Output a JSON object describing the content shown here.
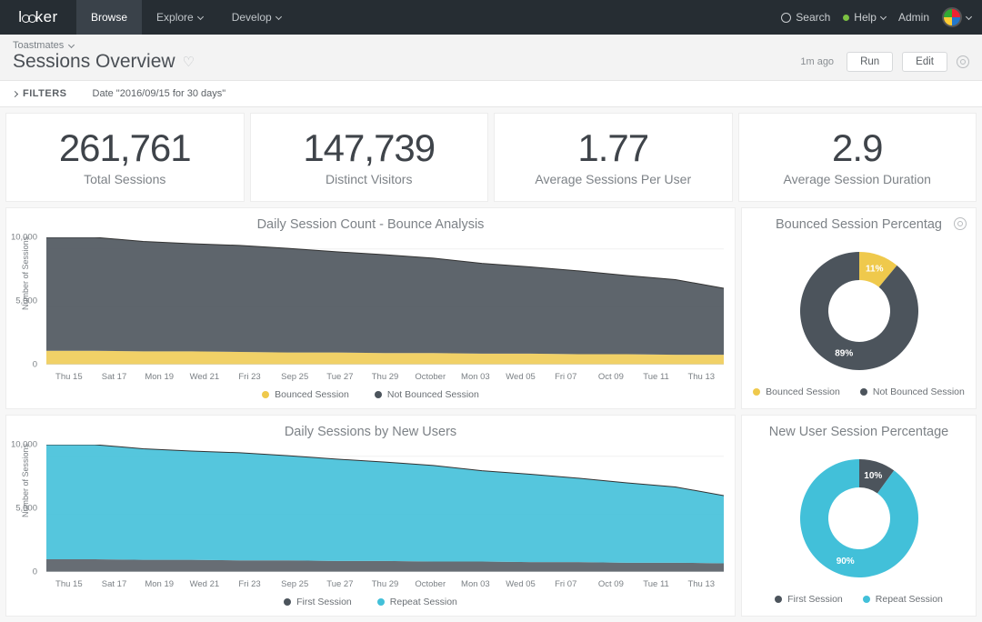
{
  "nav": {
    "logo_prefix": "l",
    "logo_mid": "",
    "logo_suffix": "ker",
    "tabs": [
      {
        "label": "Browse",
        "active": true
      },
      {
        "label": "Explore"
      },
      {
        "label": "Develop"
      }
    ],
    "search": "Search",
    "help": "Help",
    "admin": "Admin"
  },
  "breadcrumb": "Toastmates",
  "title": "Sessions Overview",
  "ago": "1m ago",
  "run_btn": "Run",
  "edit_btn": "Edit",
  "filters_label": "FILTERS",
  "filters_text": "Date \"2016/09/15 for 30 days\"",
  "kpis": [
    {
      "value": "261,761",
      "label": "Total Sessions"
    },
    {
      "value": "147,739",
      "label": "Distinct Visitors"
    },
    {
      "value": "1.77",
      "label": "Average Sessions Per User"
    },
    {
      "value": "2.9",
      "label": "Average Session Duration"
    }
  ],
  "chart_data": [
    {
      "type": "area",
      "title": "Daily Session Count - Bounce Analysis",
      "ylabel": "Number of Sessions",
      "ylim": [
        0,
        11000
      ],
      "yticks": [
        0,
        5000,
        10000
      ],
      "categories": [
        "Thu 15",
        "Sat 17",
        "Mon 19",
        "Wed 21",
        "Fri 23",
        "Sep 25",
        "Tue 27",
        "Thu 29",
        "October",
        "Mon 03",
        "Wed 05",
        "Fri 07",
        "Oct 09",
        "Tue 11",
        "Thu 13"
      ],
      "series": [
        {
          "name": "Bounced Session",
          "color": "#efc94c",
          "values": [
            1200,
            1200,
            1150,
            1150,
            1100,
            1050,
            1050,
            1000,
            1000,
            950,
            950,
            900,
            900,
            850,
            850
          ]
        },
        {
          "name": "Not Bounced Session",
          "color": "#4c545c",
          "values": [
            9800,
            9800,
            9500,
            9300,
            9200,
            9000,
            8700,
            8500,
            8200,
            7800,
            7500,
            7200,
            6800,
            6500,
            5750
          ]
        }
      ],
      "legend": [
        "Bounced Session",
        "Not Bounced Session"
      ]
    },
    {
      "type": "pie",
      "title": "Bounced Session Percentag",
      "series": [
        {
          "name": "Bounced Session",
          "value": 11,
          "color": "#efc94c"
        },
        {
          "name": "Not Bounced Session",
          "value": 89,
          "color": "#4c545c"
        }
      ],
      "legend": [
        "Bounced Session",
        "Not Bounced Session"
      ]
    },
    {
      "type": "area",
      "title": "Daily Sessions by New Users",
      "ylabel": "Number of Sessions",
      "ylim": [
        0,
        11000
      ],
      "yticks": [
        0,
        5000,
        10000
      ],
      "categories": [
        "Thu 15",
        "Sat 17",
        "Mon 19",
        "Wed 21",
        "Fri 23",
        "Sep 25",
        "Tue 27",
        "Thu 29",
        "October",
        "Mon 03",
        "Wed 05",
        "Fri 07",
        "Oct 09",
        "Tue 11",
        "Thu 13"
      ],
      "series": [
        {
          "name": "First Session",
          "color": "#4c545c",
          "values": [
            1100,
            1100,
            1050,
            1050,
            1000,
            1000,
            950,
            950,
            900,
            900,
            850,
            850,
            800,
            800,
            750
          ]
        },
        {
          "name": "Repeat Session",
          "color": "#42c0d9",
          "values": [
            9900,
            9900,
            9600,
            9400,
            9300,
            9050,
            8800,
            8550,
            8300,
            7850,
            7600,
            7250,
            6900,
            6550,
            5850
          ]
        }
      ],
      "legend": [
        "First Session",
        "Repeat Session"
      ]
    },
    {
      "type": "pie",
      "title": "New User Session Percentage",
      "series": [
        {
          "name": "First Session",
          "value": 10,
          "color": "#4c545c"
        },
        {
          "name": "Repeat Session",
          "value": 90,
          "color": "#42c0d9"
        }
      ],
      "legend": [
        "First Session",
        "Repeat Session"
      ]
    }
  ]
}
